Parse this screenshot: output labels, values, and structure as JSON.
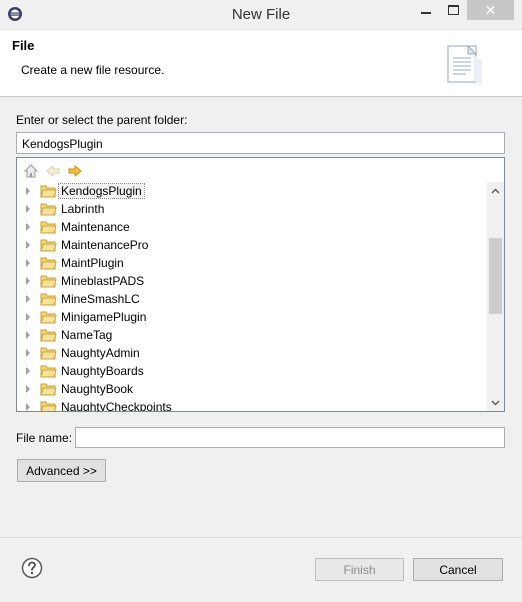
{
  "window": {
    "title": "New File"
  },
  "banner": {
    "title": "File",
    "description": "Create a new file resource."
  },
  "parent_folder": {
    "label": "Enter or select the parent folder:",
    "value": "KendogsPlugin"
  },
  "tree": {
    "items": [
      {
        "label": "KendogsPlugin",
        "selected": true
      },
      {
        "label": "Labrinth"
      },
      {
        "label": "Maintenance"
      },
      {
        "label": "MaintenancePro"
      },
      {
        "label": "MaintPlugin"
      },
      {
        "label": "MineblastPADS"
      },
      {
        "label": "MineSmashLC"
      },
      {
        "label": "MinigamePlugin"
      },
      {
        "label": "NameTag"
      },
      {
        "label": "NaughtyAdmin"
      },
      {
        "label": "NaughtyBoards"
      },
      {
        "label": "NaughtyBook"
      },
      {
        "label": "NaughtyCheckpoints"
      }
    ]
  },
  "file_name": {
    "label": "File name:",
    "value": ""
  },
  "buttons": {
    "advanced": "Advanced >>",
    "finish": "Finish",
    "cancel": "Cancel"
  },
  "icons": {
    "app": "eclipse-icon",
    "home": "home-icon",
    "back": "back-arrow-icon",
    "forward": "forward-arrow-icon",
    "folder": "folder-icon",
    "help": "help-icon",
    "banner": "new-file-icon"
  }
}
